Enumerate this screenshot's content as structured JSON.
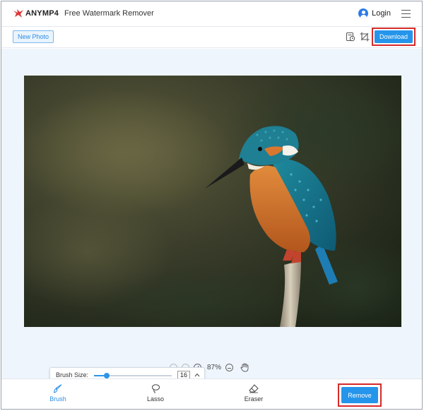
{
  "header": {
    "brand": "ANYMP4",
    "app_title": "Free Watermark Remover",
    "login_label": "Login",
    "icons": {
      "user": "user-icon",
      "menu": "hamburger-menu-icon",
      "logo": "anymp4-logo-icon"
    }
  },
  "toolbar": {
    "new_photo_label": "New Photo",
    "download_label": "Download",
    "icons": {
      "history": "history-icon",
      "crop": "crop-icon"
    }
  },
  "canvas": {
    "image_subject": "kingfisher-photo",
    "zoom_value": "87%",
    "icons": {
      "zoom_in": "zoom-in-icon",
      "zoom_out": "zoom-out-icon",
      "pan": "hand-icon"
    }
  },
  "brush_popup": {
    "label": "Brush Size:",
    "value": "16",
    "slider_fraction": 0.16
  },
  "bottom": {
    "tools": [
      {
        "label": "Brush",
        "icon": "brush-icon",
        "active": true
      },
      {
        "label": "Lasso",
        "icon": "lasso-icon",
        "active": false
      },
      {
        "label": "Eraser",
        "icon": "eraser-icon",
        "active": false
      }
    ],
    "remove_label": "Remove"
  },
  "colors": {
    "accent": "#2495ea",
    "highlight_border": "#d62a2a",
    "canvas_bg": "#eef5fd"
  }
}
